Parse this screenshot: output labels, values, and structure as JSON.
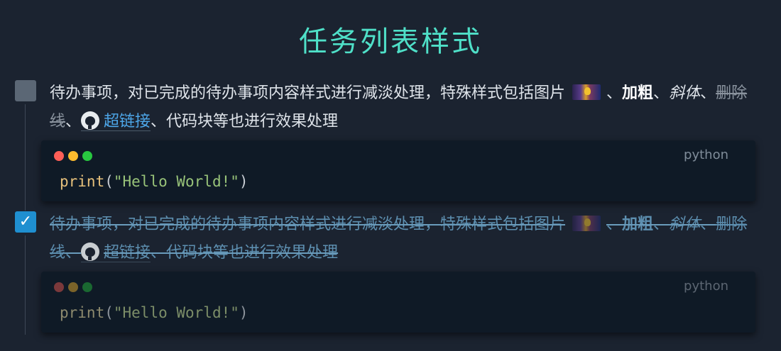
{
  "title": "任务列表样式",
  "tasks": [
    {
      "checked": false,
      "text_before_pic": "待办事项，对已完成的待办事项内容样式进行减淡处理，特殊样式包括图片",
      "sep1": "、",
      "bold": "加粗",
      "sep2": "、",
      "italic": "斜体",
      "sep3": "、",
      "strike": "删除线",
      "sep4": "、",
      "link": "超链接",
      "text_after": "、代码块等也进行效果处理",
      "code": {
        "lang": "python",
        "fn": "print",
        "open": "(",
        "string": "\"Hello World!\"",
        "close": ")"
      }
    },
    {
      "checked": true,
      "checkmark": "✓",
      "text_before_pic": "待办事项，对已完成的待办事项内容样式进行减淡处理，特殊样式包括图片",
      "sep1": "、",
      "bold": "加粗",
      "sep2": "、",
      "italic": "斜体",
      "sep3": "、",
      "strike": "删除线",
      "sep4": "、",
      "link": "超链接",
      "text_after": "、代码块等也进行效果处理",
      "code": {
        "lang": "python",
        "fn": "print",
        "open": "(",
        "string": "\"Hello World!\"",
        "close": ")"
      }
    }
  ],
  "icons": {
    "image": "image-icon",
    "github": "github-icon"
  }
}
